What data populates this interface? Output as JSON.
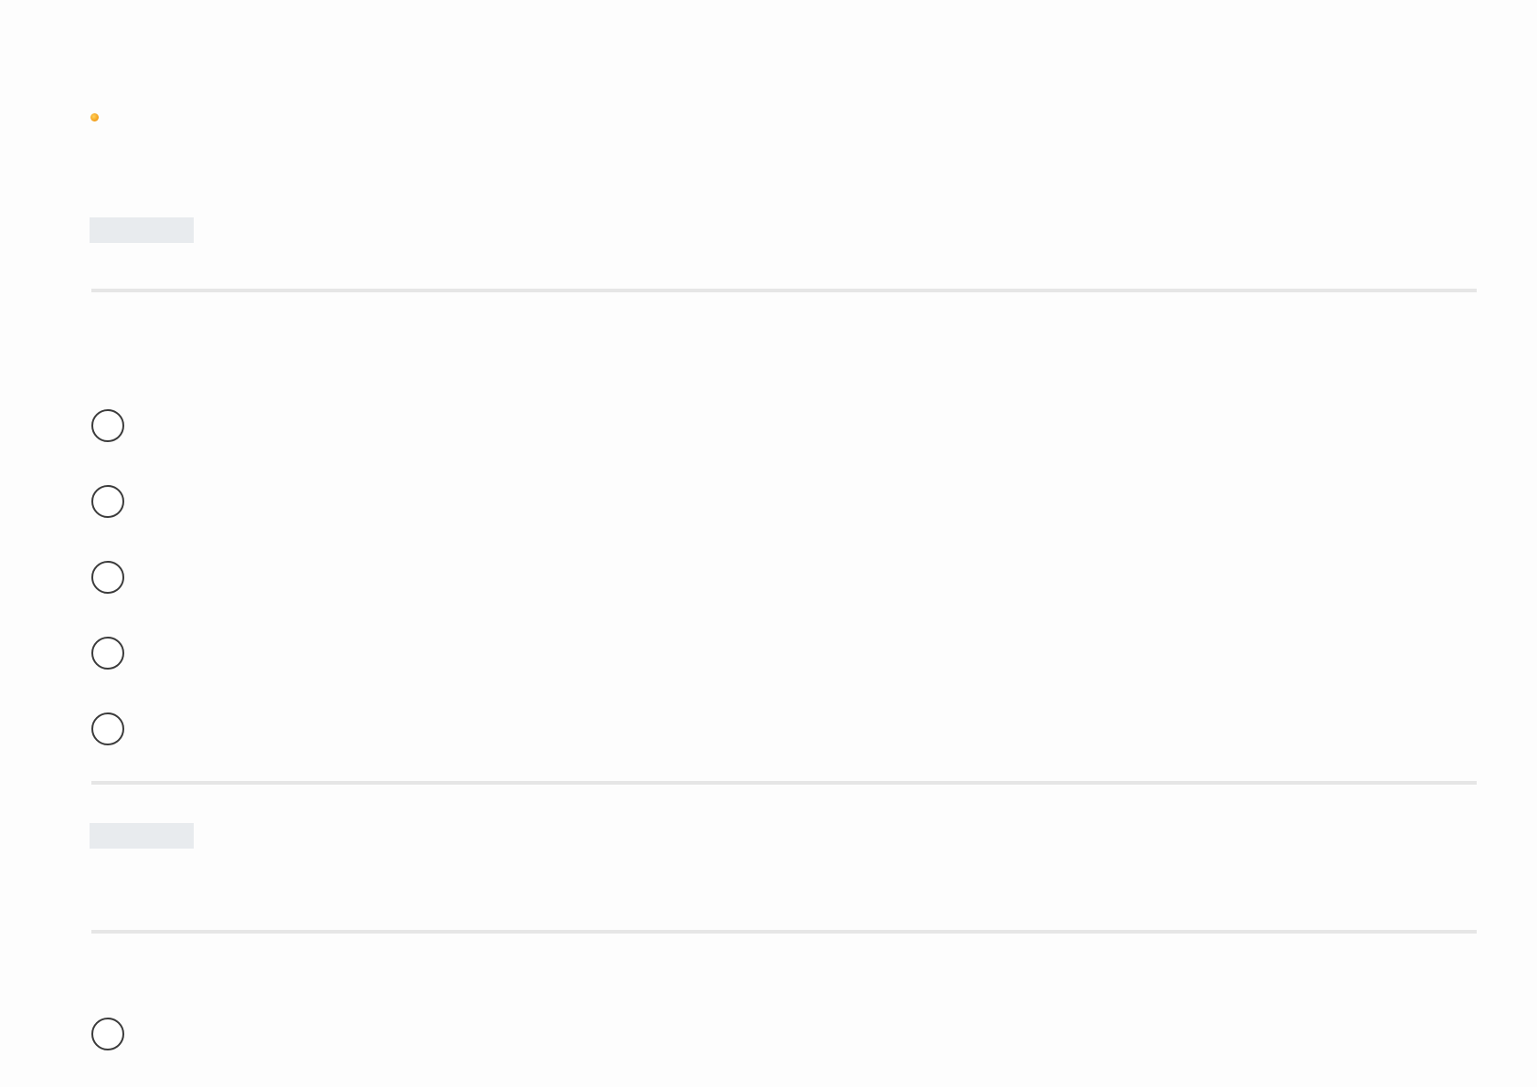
{
  "logo": {
    "icon": "logo-dot-icon",
    "color": "#f5a623"
  },
  "question_1": {
    "label": "",
    "options": [
      {
        "label": "",
        "selected": false
      },
      {
        "label": "",
        "selected": false
      },
      {
        "label": "",
        "selected": false
      },
      {
        "label": "",
        "selected": false
      },
      {
        "label": "",
        "selected": false
      }
    ]
  },
  "question_2": {
    "label": "",
    "options": [
      {
        "label": "",
        "selected": false
      }
    ]
  },
  "colors": {
    "background": "#fdfdfd",
    "placeholder": "#e8ebee",
    "divider": "#e6e6e6",
    "radio_border": "#3b3b3b"
  }
}
